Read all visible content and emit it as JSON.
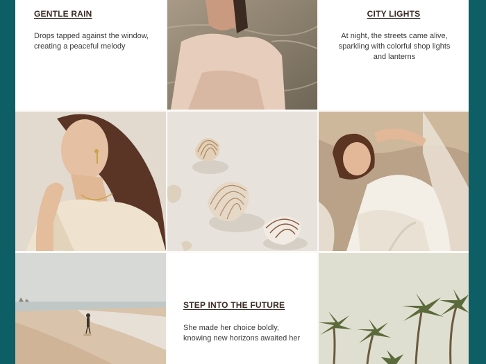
{
  "cards": [
    {
      "title": "GENTLE RAIN",
      "description": "Drops tapped against the window, creating a peaceful melody"
    },
    {
      "title": "CITY LIGHTS",
      "description": "At night, the streets came alive, sparkling with colorful shop lights and lanterns"
    },
    {
      "title": "STEP INTO THE FUTURE",
      "description": "She made her choice boldly, knowing new horizons awaited her"
    }
  ],
  "photos": [
    {
      "name": "woman-in-water-photo"
    },
    {
      "name": "woman-portrait-photo"
    },
    {
      "name": "seashells-photo"
    },
    {
      "name": "woman-in-surf-photo"
    },
    {
      "name": "beach-walker-photo"
    },
    {
      "name": "palm-trees-photo"
    }
  ],
  "colors": {
    "page_background": "#0e5e66",
    "card_background": "#ffffff",
    "title_color": "#3a2a22"
  }
}
